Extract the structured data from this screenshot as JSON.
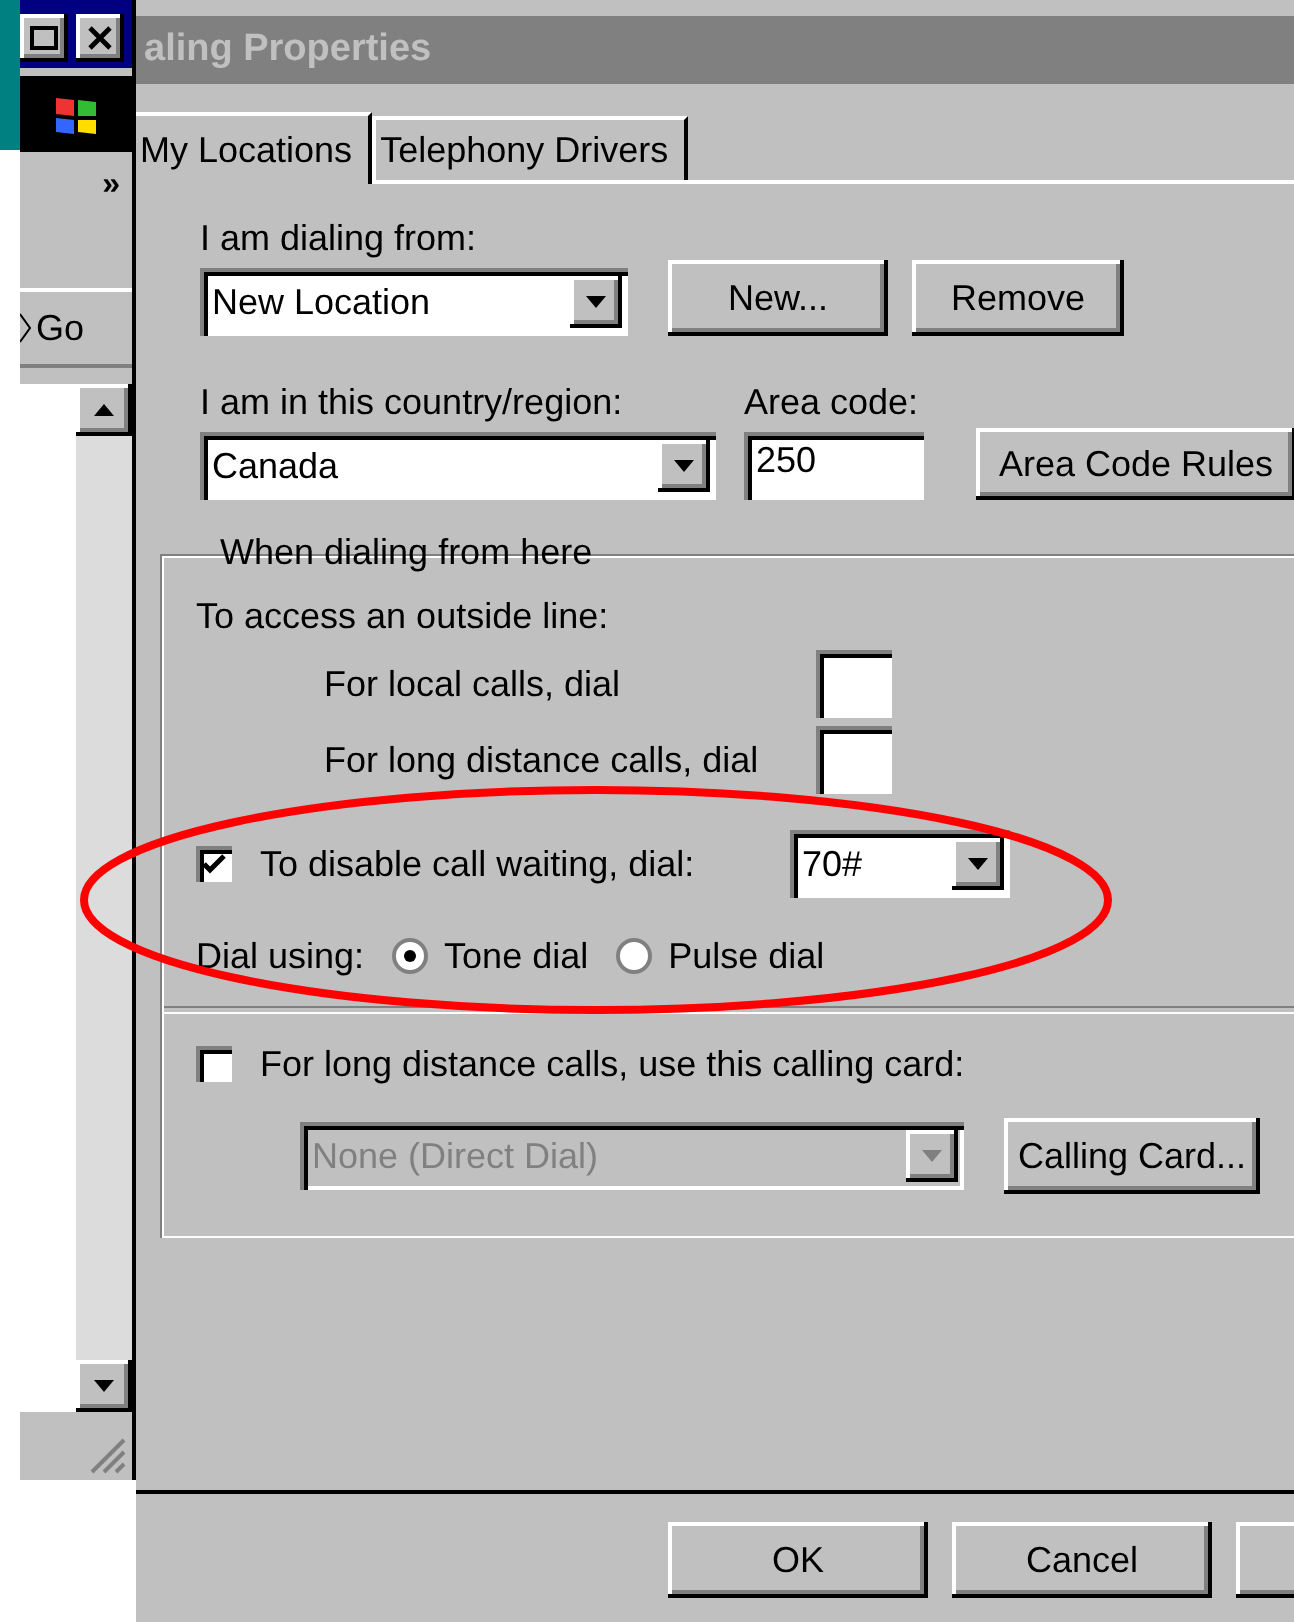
{
  "side_window": {
    "toolbar_chevron": "»",
    "go_button": "Go"
  },
  "dialog": {
    "title": "aling Properties",
    "tabs": [
      {
        "label": "My Locations",
        "selected": true
      },
      {
        "label": "Telephony Drivers",
        "selected": false
      }
    ],
    "dialing_from": {
      "label": "I am dialing from:",
      "value": "New Location"
    },
    "location_buttons": [
      "New...",
      "Remove"
    ],
    "country": {
      "label": "I am in this country/region:",
      "value": "Canada"
    },
    "area_code": {
      "label": "Area code:",
      "value": "250"
    },
    "area_code_rules_button": "Area Code Rules",
    "group": {
      "title": "When dialing from here",
      "outside_line_label": "To access an outside line:",
      "prefix_fields": [
        {
          "label": "For local calls, dial"
        },
        {
          "label": "For long distance calls, dial"
        }
      ],
      "call_waiting": {
        "label": "To disable call waiting, dial:",
        "checked": true,
        "value": "70#"
      },
      "dial_using": {
        "label": "Dial using:",
        "options": [
          {
            "label": "Tone dial",
            "selected": true
          },
          {
            "label": "Pulse dial",
            "selected": false
          }
        ]
      },
      "calling_card": {
        "label": "For long distance calls, use this calling card:",
        "checked": false,
        "value": "None (Direct Dial)",
        "disabled": true,
        "button": "Calling Card..."
      }
    },
    "footer_buttons": [
      "OK",
      "Cancel"
    ]
  },
  "annotation": {
    "kind": "ellipse"
  }
}
